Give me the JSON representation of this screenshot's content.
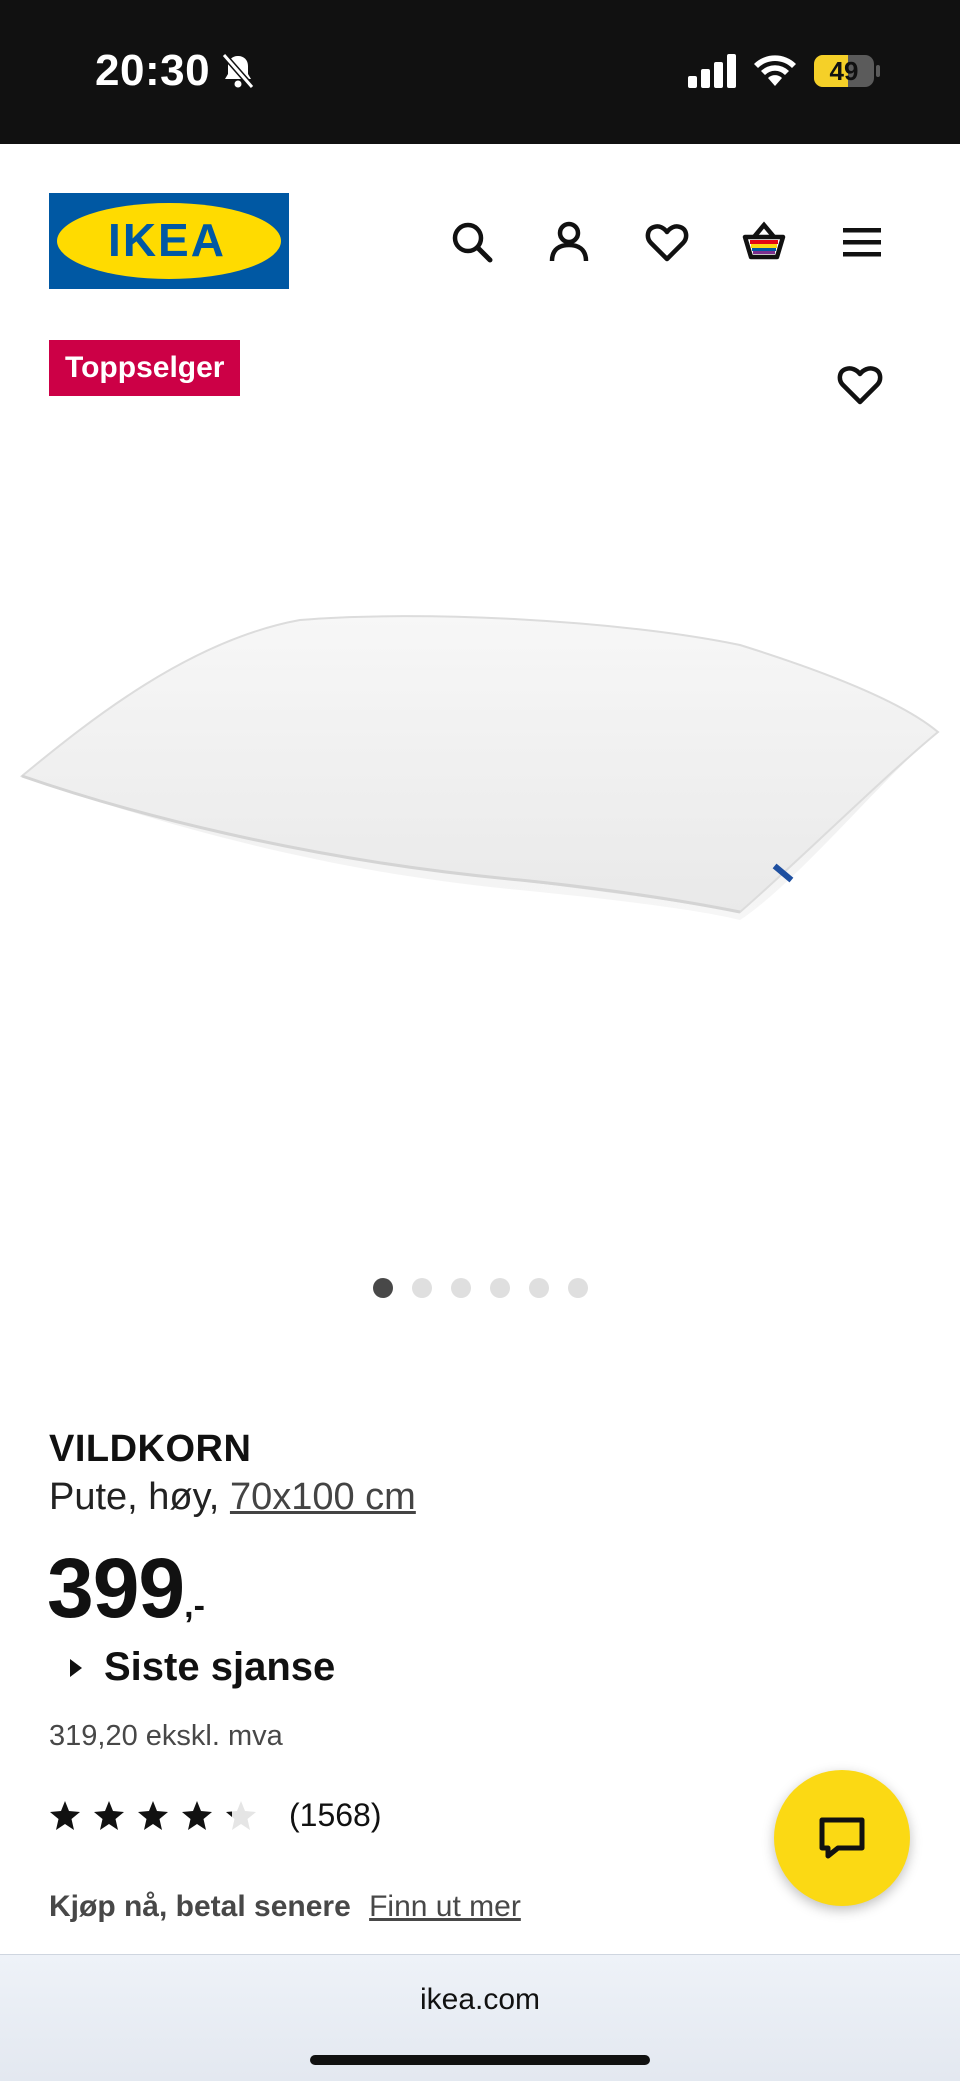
{
  "status_bar": {
    "time": "20:30",
    "battery": "49",
    "icons": [
      "bell-slash-icon",
      "signal-icon",
      "wifi-icon",
      "battery-icon"
    ]
  },
  "header": {
    "logo_text": "IKEA",
    "icons": [
      "search-icon",
      "user-icon",
      "heart-icon",
      "basket-icon",
      "menu-icon"
    ]
  },
  "product": {
    "badge": "Toppselger",
    "name": "VILDKORN",
    "description": "Pute, høy, ",
    "size": "70x100 cm",
    "price_main": "399",
    "price_suffix": ",-",
    "last_chance": "Siste sjanse",
    "ex_vat": "319,20 ekskl. mva",
    "rating_value": 4,
    "rating_max": 5,
    "rating_count": "(1568)",
    "image_count": 6,
    "image_active": 1
  },
  "financing": {
    "label": "Kjøp nå, betal senere",
    "link": "Finn ut mer"
  },
  "browser": {
    "url": "ikea.com"
  },
  "colors": {
    "badge": "#cc0046",
    "chat_button": "#fbd914",
    "ikea_blue": "#0058a3",
    "ikea_yellow": "#ffdb00"
  }
}
